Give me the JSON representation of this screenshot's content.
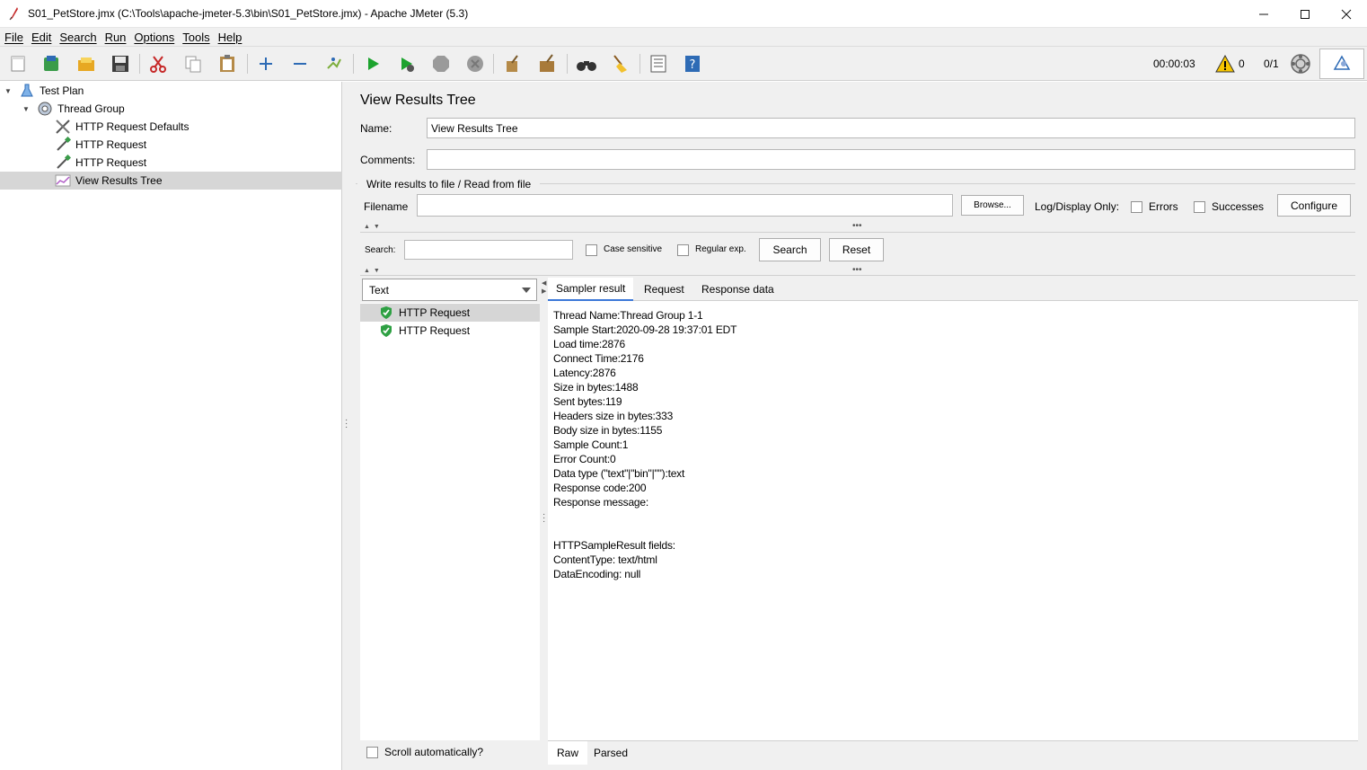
{
  "window": {
    "title": "S01_PetStore.jmx (C:\\Tools\\apache-jmeter-5.3\\bin\\S01_PetStore.jmx) - Apache JMeter (5.3)",
    "minimize": "—",
    "maximize": "☐",
    "close": "✕"
  },
  "menu": [
    "File",
    "Edit",
    "Search",
    "Run",
    "Options",
    "Tools",
    "Help"
  ],
  "toolbar": {
    "buttons": [
      "new-icon",
      "templates-icon",
      "open-icon",
      "save-icon",
      "cut-icon",
      "copy-icon",
      "paste-icon",
      "expand-icon",
      "collapse-icon",
      "toggle-icon",
      "start-icon",
      "start-no-pause-icon",
      "stop-icon",
      "shutdown-icon",
      "clear-icon",
      "clear-all-icon",
      "search-icon",
      "reset-search-icon",
      "function-helper-icon",
      "help-icon"
    ],
    "timer": "00:00:03",
    "warning_count": "0",
    "threads": "0/1"
  },
  "tree": {
    "items": [
      {
        "label": "Test Plan",
        "icon": "test-plan-icon"
      },
      {
        "label": "Thread Group",
        "icon": "thread-group-icon"
      },
      {
        "label": "HTTP Request Defaults",
        "icon": "config-icon"
      },
      {
        "label": "HTTP Request",
        "icon": "sampler-icon"
      },
      {
        "label": "HTTP Request",
        "icon": "sampler-icon"
      },
      {
        "label": "View Results Tree",
        "icon": "listener-icon"
      }
    ],
    "selected_index": 5
  },
  "panel": {
    "title": "View Results Tree",
    "name_label": "Name:",
    "name_value": "View Results Tree",
    "comments_label": "Comments:",
    "comments_value": "",
    "file_group": "Write results to file / Read from file",
    "filename_label": "Filename",
    "filename_value": "",
    "browse": "Browse...",
    "log_display": "Log/Display Only:",
    "errors": "Errors",
    "successes": "Successes",
    "configure": "Configure",
    "search_label": "Search:",
    "search_value": "",
    "case_sensitive": "Case sensitive",
    "regular_exp": "Regular exp.",
    "search_btn": "Search",
    "reset_btn": "Reset"
  },
  "results": {
    "renderer": "Text",
    "items": [
      "HTTP Request",
      "HTTP Request"
    ],
    "scroll_auto": "Scroll automatically?"
  },
  "detail": {
    "tabs": [
      "Sampler result",
      "Request",
      "Response data"
    ],
    "lines": [
      "Thread Name:Thread Group 1-1",
      "Sample Start:2020-09-28 19:37:01 EDT",
      "Load time:2876",
      "Connect Time:2176",
      "Latency:2876",
      "Size in bytes:1488",
      "Sent bytes:119",
      "Headers size in bytes:333",
      "Body size in bytes:1155",
      "Sample Count:1",
      "Error Count:0",
      "Data type (\"text\"|\"bin\"|\"\"):text",
      "Response code:200",
      "Response message:",
      "",
      "",
      "HTTPSampleResult fields:",
      "ContentType: text/html",
      "DataEncoding: null"
    ],
    "bottom_tabs": [
      "Raw",
      "Parsed"
    ]
  }
}
